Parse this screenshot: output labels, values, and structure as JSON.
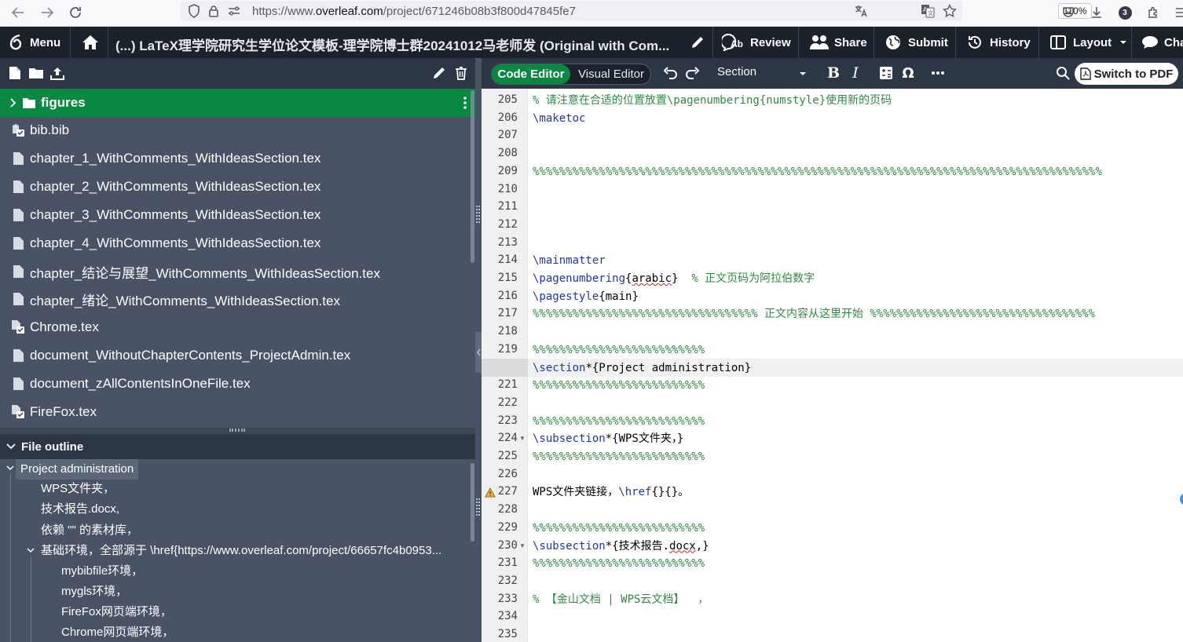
{
  "browser": {
    "url_prefix": "https://www.",
    "url_host": "overleaf.com",
    "url_path": "/project/671246b08b3f800d47845fe7",
    "zoom": "110%",
    "ext_badge": "3"
  },
  "header": {
    "menu": "Menu",
    "title": "(...) LaTeX理学院研究生学位论文模板-理学院博士群20241012马老师发 (Original with Com...",
    "review": "Review",
    "share": "Share",
    "submit": "Submit",
    "history": "History",
    "layout": "Layout",
    "chat": "Cha"
  },
  "toolbar": {
    "code_editor": "Code Editor",
    "visual_editor": "Visual Editor",
    "section": "Section",
    "switch_pdf": "Switch to PDF"
  },
  "file_tree": [
    {
      "name": "figures",
      "type": "folder"
    },
    {
      "name": "bib.bib",
      "type": "bib"
    },
    {
      "name": "chapter_1_WithComments_WithIdeasSection.tex",
      "type": "file"
    },
    {
      "name": "chapter_2_WithComments_WithIdeasSection.tex",
      "type": "file"
    },
    {
      "name": "chapter_3_WithComments_WithIdeasSection.tex",
      "type": "file"
    },
    {
      "name": "chapter_4_WithComments_WithIdeasSection.tex",
      "type": "file"
    },
    {
      "name": "chapter_结论与展望_WithComments_WithIdeasSection.tex",
      "type": "file"
    },
    {
      "name": "chapter_绪论_WithComments_WithIdeasSection.tex",
      "type": "file"
    },
    {
      "name": "Chrome.tex",
      "type": "linked"
    },
    {
      "name": "document_WithoutChapterContents_ProjectAdmin.tex",
      "type": "file"
    },
    {
      "name": "document_zAllContentsInOneFile.tex",
      "type": "file"
    },
    {
      "name": "FireFox.tex",
      "type": "linked"
    }
  ],
  "outline": {
    "title": "File outline",
    "items": [
      {
        "label": "Project administration",
        "level": 0
      },
      {
        "label": "WPS文件夹，",
        "level": 1
      },
      {
        "label": "技术报告.docx,",
        "level": 1
      },
      {
        "label": "依赖 \"\" 的素材库，",
        "level": 1
      },
      {
        "label": "基础环境，全部源于 \\href{https://www.overleaf.com/project/66657fc4b0953...",
        "level": 1
      },
      {
        "label": "mybibfile环境，",
        "level": 2
      },
      {
        "label": "mygls环境，",
        "level": 2
      },
      {
        "label": "FireFox网页端环境，",
        "level": 2
      },
      {
        "label": "Chrome网页端环境，",
        "level": 2
      }
    ]
  },
  "editor": {
    "lines": [
      {
        "n": "205",
        "t": "% 请注意在合适的位置放置\\pagenumbering{numstyle}使用新的页码"
      },
      {
        "n": "206",
        "t": "\\maketoc"
      },
      {
        "n": "207",
        "t": ""
      },
      {
        "n": "208",
        "t": ""
      },
      {
        "n": "209",
        "t": "%%%%%%%%%%%%%%%%%%%%%%%%%%%%%%%%%%%%%%%%%%%%%%%%%%%%%%%%%%%%%%%%%%%%%%%%%%%%%%%%%%%%%%"
      },
      {
        "n": "210",
        "t": ""
      },
      {
        "n": "211",
        "t": ""
      },
      {
        "n": "212",
        "t": ""
      },
      {
        "n": "213",
        "t": ""
      },
      {
        "n": "214",
        "t": "\\mainmatter"
      },
      {
        "n": "215",
        "t": "\\pagenumbering{arabic}  % 正文页码为阿拉伯数字"
      },
      {
        "n": "216",
        "t": "\\pagestyle{main}"
      },
      {
        "n": "217",
        "t": "%%%%%%%%%%%%%%%%%%%%%%%%%%%%%%%%%% 正文内容从这里开始 %%%%%%%%%%%%%%%%%%%%%%%%%%%%%%%%%%"
      },
      {
        "n": "218",
        "t": ""
      },
      {
        "n": "219",
        "t": "%%%%%%%%%%%%%%%%%%%%%%%%%%"
      },
      {
        "n": "220",
        "t": "\\section*{Project administration}"
      },
      {
        "n": "221",
        "t": "%%%%%%%%%%%%%%%%%%%%%%%%%%"
      },
      {
        "n": "222",
        "t": ""
      },
      {
        "n": "223",
        "t": "%%%%%%%%%%%%%%%%%%%%%%%%%%"
      },
      {
        "n": "224",
        "t": "\\subsection*{WPS文件夹，}"
      },
      {
        "n": "225",
        "t": "%%%%%%%%%%%%%%%%%%%%%%%%%%"
      },
      {
        "n": "226",
        "t": ""
      },
      {
        "n": "227",
        "t": "WPS文件夹链接，\\href{}{}。"
      },
      {
        "n": "228",
        "t": ""
      },
      {
        "n": "229",
        "t": "%%%%%%%%%%%%%%%%%%%%%%%%%%"
      },
      {
        "n": "230",
        "t": "\\subsection*{技术报告.docx,}"
      },
      {
        "n": "231",
        "t": "%%%%%%%%%%%%%%%%%%%%%%%%%%"
      },
      {
        "n": "232",
        "t": ""
      },
      {
        "n": "233",
        "t": "% 【金山文档 | WPS云文档】  ，"
      },
      {
        "n": "234",
        "t": ""
      },
      {
        "n": "235",
        "t": ""
      }
    ]
  },
  "colors": {
    "accent_green": "#098842",
    "header_bg": "#1b222c",
    "panel_bg": "#495365",
    "comment": "#2f8a45",
    "command": "#1f35b5"
  }
}
